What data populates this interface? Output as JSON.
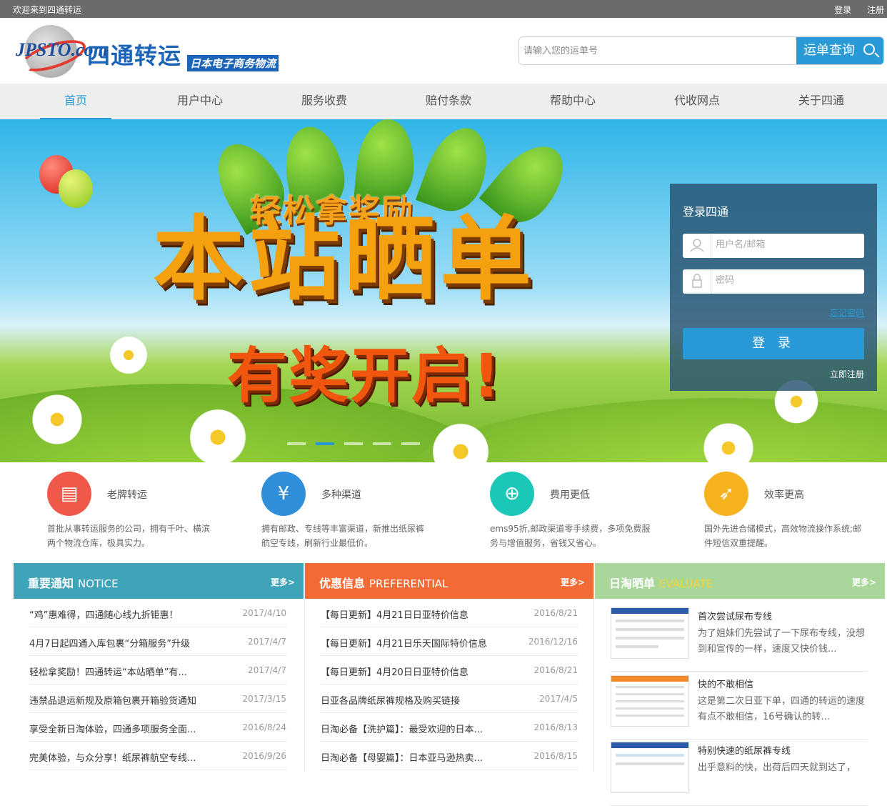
{
  "topbar": {
    "welcome": "欢迎来到四通转运",
    "login": "登录",
    "register": "注册"
  },
  "logo": {
    "jp": "JPSTO.com",
    "name": "四通转运",
    "sub": "日本电子商务物流"
  },
  "search": {
    "placeholder": "请输入您的运单号",
    "button": "运单查询"
  },
  "nav": [
    "首页",
    "用户中心",
    "服务收费",
    "赔付条款",
    "帮助中心",
    "代收网点",
    "关于四通"
  ],
  "banner": {
    "line1": "轻松拿奖励",
    "line2": "本站晒单",
    "line3": "有奖开启!",
    "slides": 5,
    "active_slide": 2
  },
  "login": {
    "title": "登录四通",
    "username_placeholder": "用户名/邮箱",
    "password_placeholder": "密码",
    "forgot": "忘记密码",
    "button": "登 录",
    "register": "立即注册"
  },
  "features": [
    {
      "title": "老牌转运",
      "desc": "首批从事转运服务的公司，拥有千叶、横滨两个物流仓库，极具实力。",
      "color": "#f0584a",
      "icon": "warehouse-icon"
    },
    {
      "title": "多种渠道",
      "desc": "拥有邮政、专线等丰富渠道，新推出纸尿裤航空专线，刷新行业最低价。",
      "color": "#2f8fdb",
      "icon": "truck-icon"
    },
    {
      "title": "费用更低",
      "desc": "ems95折,邮政渠道零手续费，多项免费服务与增值服务，省钱又省心。",
      "color": "#1bc7b6",
      "icon": "target-icon"
    },
    {
      "title": "效率更高",
      "desc": "国外先进合储模式，高效物流操作系统;邮件短信双重提醒。",
      "color": "#f7b21f",
      "icon": "rocket-icon"
    }
  ],
  "notice": {
    "title": "重要通知",
    "en": "NOTICE",
    "more": "更多>",
    "color": "#3fa4b9",
    "items": [
      {
        "text": "“鸡”惠难得，四通随心线九折钜惠！",
        "date": "2017/4/10"
      },
      {
        "text": "4月7日起四通入库包裹“分箱服务”升级",
        "date": "2017/4/7"
      },
      {
        "text": "轻松拿奖励！四通转运“本站晒单”有...",
        "date": "2017/4/7"
      },
      {
        "text": "违禁品退运新规及原箱包裹开箱验货通知",
        "date": "2017/3/15"
      },
      {
        "text": "享受全新日淘体验，四通多项服务全面...",
        "date": "2016/8/24"
      },
      {
        "text": "完美体验，与众分享！纸尿裤航空专线...",
        "date": "2016/9/26"
      }
    ]
  },
  "preferential": {
    "title": "优惠信息",
    "en": "PREFERENTIAL",
    "more": "更多>",
    "color": "#f36a34",
    "items": [
      {
        "text": "【每日更新】4月21日日亚特价信息",
        "date": "2016/8/21"
      },
      {
        "text": "【每日更新】4月21日乐天国际特价信息",
        "date": "2016/12/16"
      },
      {
        "text": "【每日更新】4月20日日亚特价信息",
        "date": "2016/8/21"
      },
      {
        "text": "日亚各品牌纸尿裤规格及购买链接",
        "date": "2017/4/5"
      },
      {
        "text": "日淘必备【洗护篇】：最受欢迎的日本...",
        "date": "2016/8/13"
      },
      {
        "text": "日淘必备【母婴篇】：日本亚马逊热卖...",
        "date": "2016/8/15"
      }
    ]
  },
  "evaluate": {
    "title": "日淘晒单",
    "en": "EVALUATE",
    "more": "更多>",
    "color": "#a9d79a",
    "en_color": "#f5d33a",
    "items": [
      {
        "title": "首次尝试尿布专线",
        "desc": "为了姐妹们先尝试了一下尿布专线，没想到和宣传的一样，速度又快价钱..."
      },
      {
        "title": "快的不敢相信",
        "desc": "这是第二次日亚下单，四通的转运的速度有点不敢相信，16号确认的转..."
      },
      {
        "title": "特别快速的纸尿裤专线",
        "desc": "出乎意料的快，出荷后四天就到达了，"
      }
    ]
  }
}
